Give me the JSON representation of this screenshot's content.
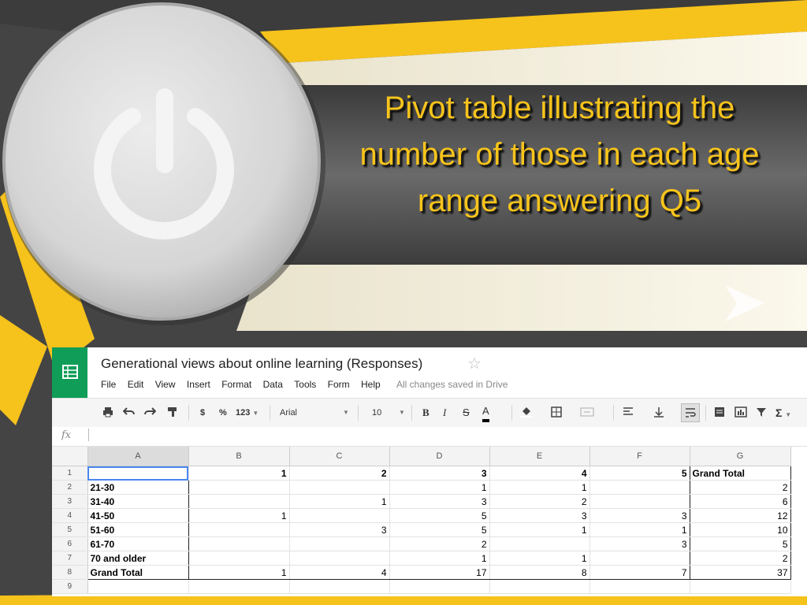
{
  "slide": {
    "title": "Pivot table illustrating the number of those in each age range answering Q5"
  },
  "sheet": {
    "doc_title": "Generational views about online learning (Responses)",
    "star_icon": "☆",
    "menu": [
      "File",
      "Edit",
      "View",
      "Insert",
      "Format",
      "Data",
      "Tools",
      "Form",
      "Help"
    ],
    "save_status": "All changes saved in Drive",
    "toolbar": {
      "currency": "$",
      "percent": "%",
      "number_format": "123",
      "font": "Arial",
      "font_size": "10",
      "bold": "B",
      "italic": "I",
      "strike": "S",
      "text_color": "A",
      "sum": "Σ"
    },
    "fx_label": "fx",
    "columns": [
      "A",
      "B",
      "C",
      "D",
      "E",
      "F",
      "G"
    ],
    "rows": [
      {
        "n": "1",
        "cells": [
          "",
          "1",
          "2",
          "3",
          "4",
          "5",
          "Grand Total"
        ]
      },
      {
        "n": "2",
        "cells": [
          "21-30",
          "",
          "",
          "1",
          "1",
          "",
          "2"
        ]
      },
      {
        "n": "3",
        "cells": [
          "31-40",
          "",
          "1",
          "3",
          "2",
          "",
          "6"
        ]
      },
      {
        "n": "4",
        "cells": [
          "41-50",
          "1",
          "",
          "5",
          "3",
          "3",
          "12"
        ]
      },
      {
        "n": "5",
        "cells": [
          "51-60",
          "",
          "3",
          "5",
          "1",
          "1",
          "10"
        ]
      },
      {
        "n": "6",
        "cells": [
          "61-70",
          "",
          "",
          "2",
          "",
          "3",
          "5"
        ]
      },
      {
        "n": "7",
        "cells": [
          "70 and older",
          "",
          "",
          "1",
          "1",
          "",
          "2"
        ]
      },
      {
        "n": "8",
        "cells": [
          "Grand Total",
          "1",
          "4",
          "17",
          "8",
          "7",
          "37"
        ]
      },
      {
        "n": "9",
        "cells": [
          "",
          "",
          "",
          "",
          "",
          "",
          ""
        ]
      }
    ],
    "colors": {
      "accent": "#0f9d58",
      "selection": "#4a87ee",
      "title_text": "#f7c41c"
    }
  }
}
